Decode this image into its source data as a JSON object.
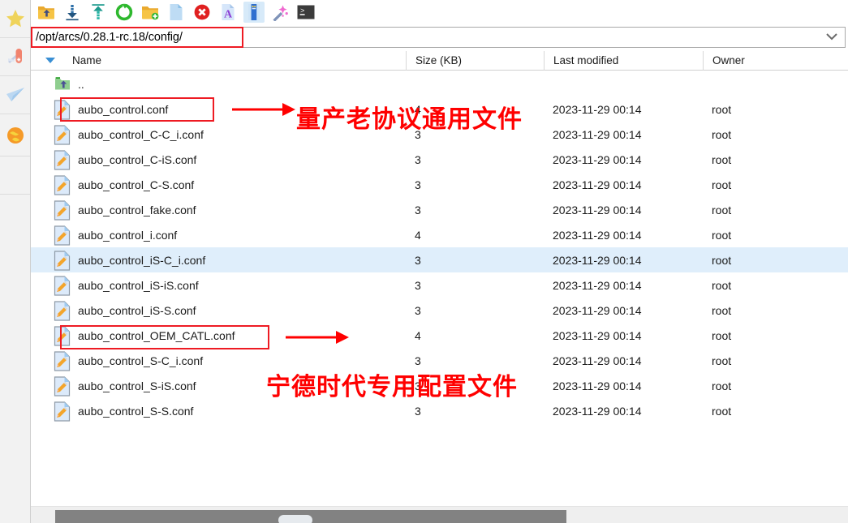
{
  "sidebar": {
    "items": [
      {
        "name": "favorites-star-icon",
        "label": "Favorites"
      },
      {
        "name": "tools-knife-icon",
        "label": "Tools"
      },
      {
        "name": "send-plane-icon",
        "label": "Send"
      },
      {
        "name": "globe-icon",
        "label": "Web"
      }
    ]
  },
  "toolbar": {
    "buttons": [
      {
        "name": "parent-folder-icon",
        "label": "Up one level"
      },
      {
        "name": "download-icon",
        "label": "Download"
      },
      {
        "name": "upload-icon",
        "label": "Upload"
      },
      {
        "name": "refresh-icon",
        "label": "Refresh"
      },
      {
        "name": "new-folder-icon",
        "label": "New folder"
      },
      {
        "name": "new-file-icon",
        "label": "New file"
      },
      {
        "name": "delete-icon",
        "label": "Delete"
      },
      {
        "name": "rename-icon",
        "label": "Rename"
      },
      {
        "name": "properties-icon",
        "label": "Properties"
      },
      {
        "name": "magic-wand-icon",
        "label": "Permissions"
      },
      {
        "name": "terminal-icon",
        "label": "Open terminal"
      }
    ]
  },
  "path": {
    "value": "/opt/arcs/0.28.1-rc.18/config/",
    "placeholder": "/",
    "dropdown_icon": "chevron-down-icon"
  },
  "columns": {
    "name": "Name",
    "size": "Size (KB)",
    "modified": "Last modified",
    "owner": "Owner",
    "sort_icon": "sort-descending-triangle-icon"
  },
  "files": [
    {
      "icon": "parent-directory-folder-icon",
      "name": "..",
      "size": "",
      "modified": "",
      "owner": "",
      "selected": false,
      "is_parent": true
    },
    {
      "icon": "conf-file-icon",
      "name": "aubo_control.conf",
      "size": "4",
      "modified": "2023-11-29 00:14",
      "owner": "root",
      "selected": false,
      "is_parent": false
    },
    {
      "icon": "conf-file-icon",
      "name": "aubo_control_C-C_i.conf",
      "size": "3",
      "modified": "2023-11-29 00:14",
      "owner": "root",
      "selected": false,
      "is_parent": false
    },
    {
      "icon": "conf-file-icon",
      "name": "aubo_control_C-iS.conf",
      "size": "3",
      "modified": "2023-11-29 00:14",
      "owner": "root",
      "selected": false,
      "is_parent": false
    },
    {
      "icon": "conf-file-icon",
      "name": "aubo_control_C-S.conf",
      "size": "3",
      "modified": "2023-11-29 00:14",
      "owner": "root",
      "selected": false,
      "is_parent": false
    },
    {
      "icon": "conf-file-icon",
      "name": "aubo_control_fake.conf",
      "size": "3",
      "modified": "2023-11-29 00:14",
      "owner": "root",
      "selected": false,
      "is_parent": false
    },
    {
      "icon": "conf-file-icon",
      "name": "aubo_control_i.conf",
      "size": "4",
      "modified": "2023-11-29 00:14",
      "owner": "root",
      "selected": false,
      "is_parent": false
    },
    {
      "icon": "conf-file-icon",
      "name": "aubo_control_iS-C_i.conf",
      "size": "3",
      "modified": "2023-11-29 00:14",
      "owner": "root",
      "selected": true,
      "is_parent": false
    },
    {
      "icon": "conf-file-icon",
      "name": "aubo_control_iS-iS.conf",
      "size": "3",
      "modified": "2023-11-29 00:14",
      "owner": "root",
      "selected": false,
      "is_parent": false
    },
    {
      "icon": "conf-file-icon",
      "name": "aubo_control_iS-S.conf",
      "size": "3",
      "modified": "2023-11-29 00:14",
      "owner": "root",
      "selected": false,
      "is_parent": false
    },
    {
      "icon": "conf-file-icon",
      "name": "aubo_control_OEM_CATL.conf",
      "size": "4",
      "modified": "2023-11-29 00:14",
      "owner": "root",
      "selected": false,
      "is_parent": false
    },
    {
      "icon": "conf-file-icon",
      "name": "aubo_control_S-C_i.conf",
      "size": "3",
      "modified": "2023-11-29 00:14",
      "owner": "root",
      "selected": false,
      "is_parent": false
    },
    {
      "icon": "conf-file-icon",
      "name": "aubo_control_S-iS.conf",
      "size": "3",
      "modified": "2023-11-29 00:14",
      "owner": "root",
      "selected": false,
      "is_parent": false
    },
    {
      "icon": "conf-file-icon",
      "name": "aubo_control_S-S.conf",
      "size": "3",
      "modified": "2023-11-29 00:14",
      "owner": "root",
      "selected": false,
      "is_parent": false
    }
  ],
  "annotations": {
    "color": "#ff0000",
    "note_general": "量产老协议通用文件",
    "note_catl": "宁德时代专用配置文件"
  }
}
